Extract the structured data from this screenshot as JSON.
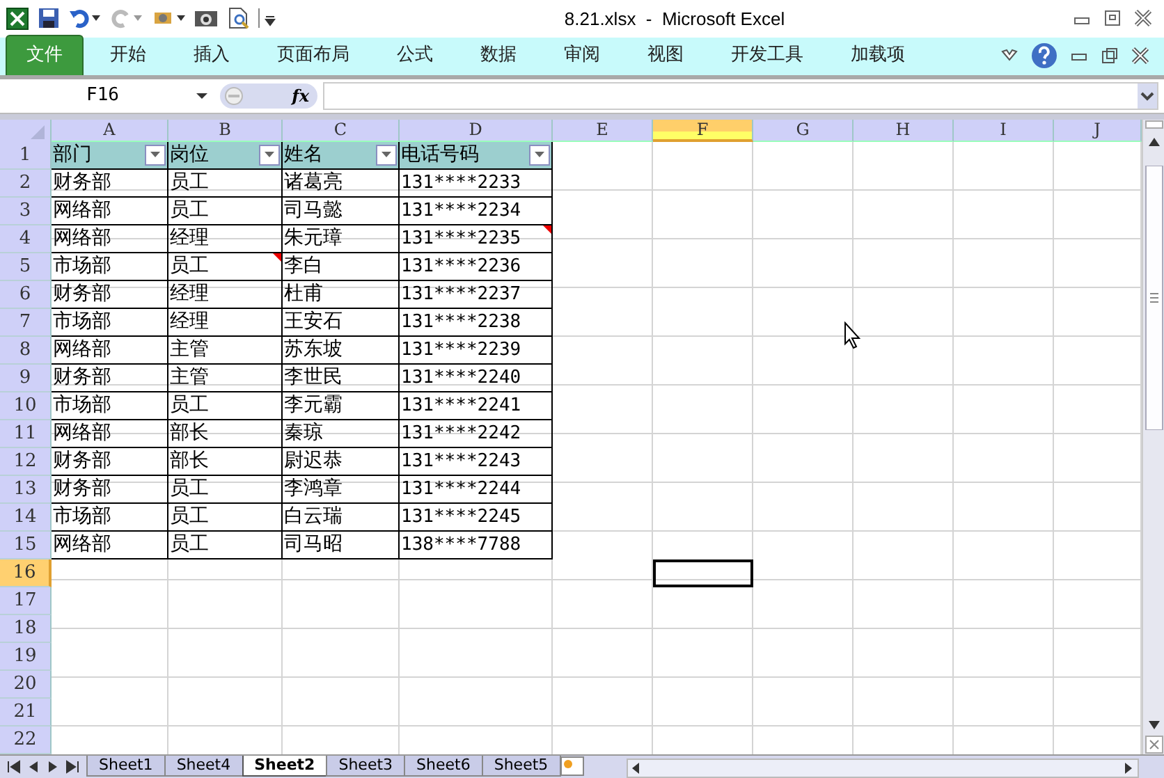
{
  "window": {
    "title": "8.21.xlsx  -  Microsoft Excel"
  },
  "ribbon_tabs": [
    {
      "label": "文件",
      "kind": "file",
      "selected": false
    },
    {
      "label": "开始",
      "kind": "tab",
      "selected": false
    },
    {
      "label": "插入",
      "kind": "tab",
      "selected": false
    },
    {
      "label": "页面布局",
      "kind": "tab",
      "selected": false
    },
    {
      "label": "公式",
      "kind": "tab",
      "selected": false
    },
    {
      "label": "数据",
      "kind": "tab",
      "selected": false
    },
    {
      "label": "审阅",
      "kind": "tab",
      "selected": false
    },
    {
      "label": "视图",
      "kind": "tab",
      "selected": false
    },
    {
      "label": "开发工具",
      "kind": "tab",
      "selected": false
    },
    {
      "label": "加载项",
      "kind": "tab",
      "selected": false
    }
  ],
  "formula_bar": {
    "name_box": "F16",
    "fx": "fx"
  },
  "columns": [
    {
      "label": "A",
      "selected": false
    },
    {
      "label": "B",
      "selected": false
    },
    {
      "label": "C",
      "selected": false
    },
    {
      "label": "D",
      "selected": false
    },
    {
      "label": "E",
      "selected": false
    },
    {
      "label": "F",
      "selected": true
    },
    {
      "label": "G",
      "selected": false
    },
    {
      "label": "H",
      "selected": false
    },
    {
      "label": "I",
      "selected": false
    },
    {
      "label": "J",
      "selected": false
    }
  ],
  "rows": [
    {
      "number": "1",
      "selected": false,
      "kind": "header",
      "cells": [
        "部门",
        "岗位",
        "姓名",
        "电话号码"
      ]
    },
    {
      "number": "2",
      "selected": false,
      "kind": "data",
      "cells": [
        "财务部",
        "员工",
        "诸葛亮",
        "131****2233"
      ]
    },
    {
      "number": "3",
      "selected": false,
      "kind": "data",
      "cells": [
        "网络部",
        "员工",
        "司马懿",
        "131****2234"
      ]
    },
    {
      "number": "4",
      "selected": false,
      "kind": "data",
      "cells": [
        "网络部",
        "经理",
        "朱元璋",
        "131****2235"
      ],
      "comments": [
        false,
        false,
        false,
        true
      ]
    },
    {
      "number": "5",
      "selected": false,
      "kind": "data",
      "cells": [
        "市场部",
        "员工",
        "李白",
        "131****2236"
      ],
      "comments": [
        false,
        true,
        false,
        false
      ]
    },
    {
      "number": "6",
      "selected": false,
      "kind": "data",
      "cells": [
        "财务部",
        "经理",
        "杜甫",
        "131****2237"
      ]
    },
    {
      "number": "7",
      "selected": false,
      "kind": "data",
      "cells": [
        "市场部",
        "经理",
        "王安石",
        "131****2238"
      ]
    },
    {
      "number": "8",
      "selected": false,
      "kind": "data",
      "cells": [
        "网络部",
        "主管",
        "苏东坡",
        "131****2239"
      ]
    },
    {
      "number": "9",
      "selected": false,
      "kind": "data",
      "cells": [
        "财务部",
        "主管",
        "李世民",
        "131****2240"
      ]
    },
    {
      "number": "10",
      "selected": false,
      "kind": "data",
      "cells": [
        "市场部",
        "员工",
        "李元霸",
        "131****2241"
      ]
    },
    {
      "number": "11",
      "selected": false,
      "kind": "data",
      "cells": [
        "网络部",
        "部长",
        "秦琼",
        "131****2242"
      ]
    },
    {
      "number": "12",
      "selected": false,
      "kind": "data",
      "cells": [
        "财务部",
        "部长",
        "尉迟恭",
        "131****2243"
      ]
    },
    {
      "number": "13",
      "selected": false,
      "kind": "data",
      "cells": [
        "财务部",
        "员工",
        "李鸿章",
        "131****2244"
      ]
    },
    {
      "number": "14",
      "selected": false,
      "kind": "data",
      "cells": [
        "市场部",
        "员工",
        "白云瑞",
        "131****2245"
      ]
    },
    {
      "number": "15",
      "selected": false,
      "kind": "data",
      "cells": [
        "网络部",
        "员工",
        "司马昭",
        "138****7788"
      ]
    },
    {
      "number": "16",
      "selected": true,
      "kind": "empty",
      "cells": []
    },
    {
      "number": "17",
      "selected": false,
      "kind": "empty",
      "cells": []
    },
    {
      "number": "18",
      "selected": false,
      "kind": "empty",
      "cells": []
    },
    {
      "number": "19",
      "selected": false,
      "kind": "empty",
      "cells": []
    },
    {
      "number": "20",
      "selected": false,
      "kind": "empty",
      "cells": []
    },
    {
      "number": "21",
      "selected": false,
      "kind": "empty",
      "cells": []
    },
    {
      "number": "22",
      "selected": false,
      "kind": "empty",
      "cells": []
    }
  ],
  "sheet_tabs": [
    {
      "label": "Sheet1",
      "selected": false
    },
    {
      "label": "Sheet4",
      "selected": false
    },
    {
      "label": "Sheet2",
      "selected": true
    },
    {
      "label": "Sheet3",
      "selected": false
    },
    {
      "label": "Sheet6",
      "selected": false
    },
    {
      "label": "Sheet5",
      "selected": false
    }
  ]
}
